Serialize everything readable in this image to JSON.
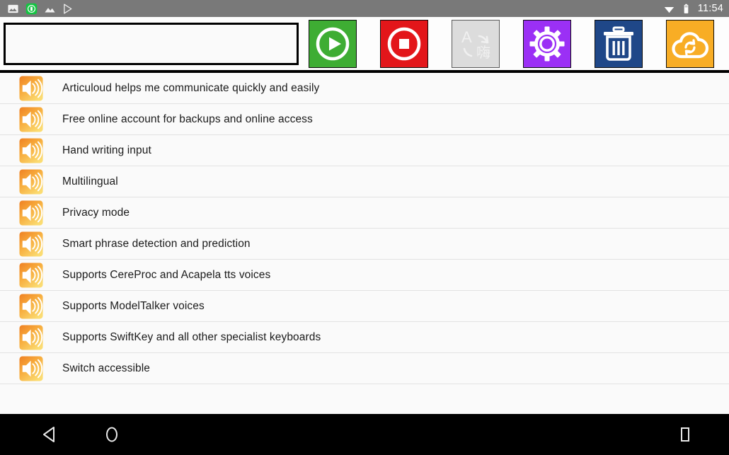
{
  "status_bar": {
    "notification_icons": [
      "image-icon",
      "articuloud-app-icon",
      "gallery-icon",
      "play-store-icon"
    ],
    "wifi_icon": "wifi-icon",
    "battery_icon": "battery-icon",
    "time": "11:54",
    "background_color": "#797979"
  },
  "toolbar": {
    "text_entry": {
      "value": "",
      "placeholder": ""
    },
    "buttons": [
      {
        "name": "play-button",
        "icon": "play-icon",
        "label": "Play",
        "color": "#3ead33",
        "enabled": true
      },
      {
        "name": "stop-button",
        "icon": "stop-icon",
        "label": "Stop",
        "color": "#e3161a",
        "enabled": true
      },
      {
        "name": "translate-button",
        "icon": "translate-icon",
        "label": "Translate",
        "color": "#dcdcdc",
        "enabled": false
      },
      {
        "name": "settings-button",
        "icon": "gear-icon",
        "label": "Settings",
        "color": "#9b30f5",
        "enabled": true
      },
      {
        "name": "delete-button",
        "icon": "trash-icon",
        "label": "Delete",
        "color": "#1f4788",
        "enabled": true
      },
      {
        "name": "cloud-sync-button",
        "icon": "cloud-sync-icon",
        "label": "Cloud sync",
        "color": "#f8ad25",
        "enabled": true
      }
    ]
  },
  "phrase_list": {
    "item_icon": "speaker-icon",
    "items": [
      {
        "text": "Articuloud helps me communicate quickly and easily"
      },
      {
        "text": "Free online account for backups and online access"
      },
      {
        "text": "Hand writing input"
      },
      {
        "text": "Multilingual"
      },
      {
        "text": "Privacy mode"
      },
      {
        "text": "Smart phrase detection and prediction"
      },
      {
        "text": "Supports CereProc and Acapela tts voices"
      },
      {
        "text": "Supports ModelTalker voices"
      },
      {
        "text": "Supports SwiftKey and all other specialist keyboards"
      },
      {
        "text": "Switch accessible"
      }
    ]
  },
  "nav_bar": {
    "back_label": "Back",
    "home_label": "Home",
    "recents_label": "Recents",
    "background_color": "#000000"
  }
}
